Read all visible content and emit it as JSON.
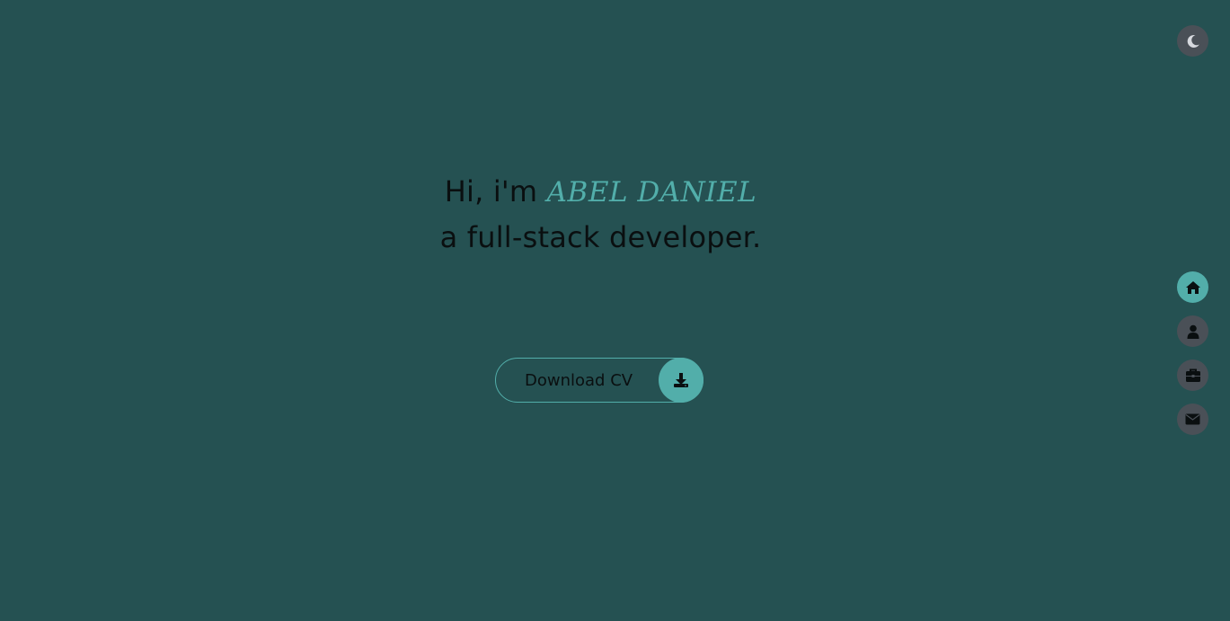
{
  "theme_toggle": {
    "icon": "moon-icon"
  },
  "hero": {
    "greeting": "Hi, i'm",
    "name": "ABEL DANIEL",
    "tagline": "a full-stack developer."
  },
  "cv_button": {
    "label": "Download CV",
    "icon": "download-icon"
  },
  "side_nav": {
    "items": [
      {
        "icon": "home-icon",
        "active": true
      },
      {
        "icon": "user-icon",
        "active": false
      },
      {
        "icon": "briefcase-icon",
        "active": false
      },
      {
        "icon": "envelope-icon",
        "active": false
      }
    ]
  },
  "colors": {
    "background": "#255152",
    "accent": "#52aeaa",
    "button_bg": "#4a5057",
    "text": "#0a0f10"
  }
}
